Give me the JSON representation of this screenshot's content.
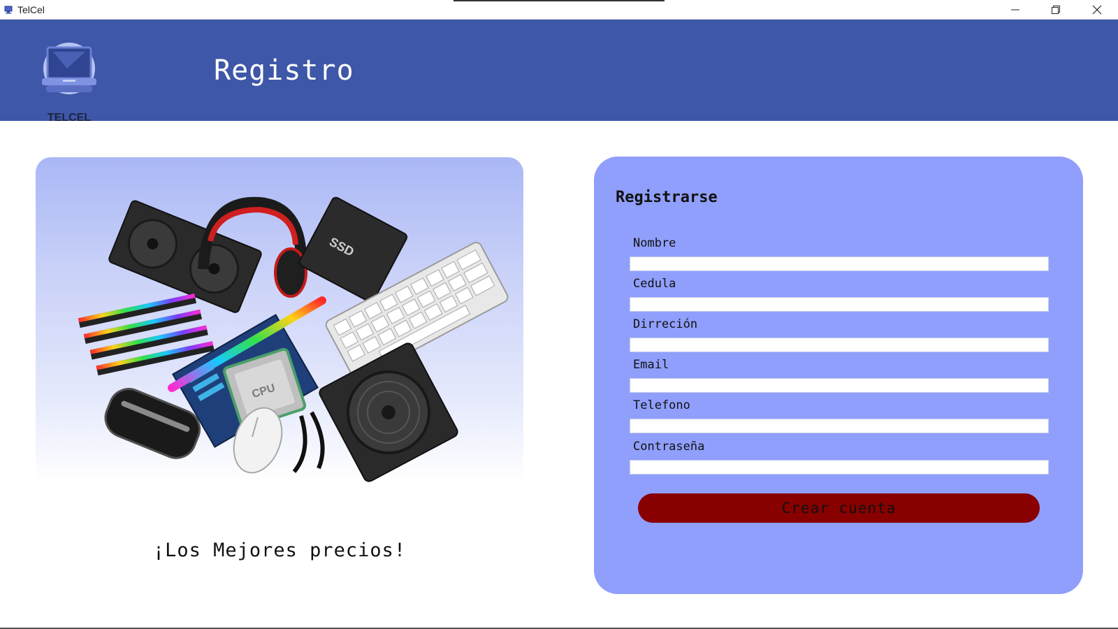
{
  "window": {
    "title": "TelCel",
    "app_icon": "computer-icon",
    "controls": [
      "minimize-icon",
      "restore-icon",
      "close-icon"
    ]
  },
  "header": {
    "logo_text": "TELCEL",
    "logo_icon": "laptop-icon",
    "title": "Registro",
    "background": "#3f57a8"
  },
  "hero": {
    "image": "computer-hardware-collage",
    "tagline": "¡Los Mejores precios!"
  },
  "form": {
    "heading": "Registrarse",
    "background": "#909ffc",
    "fields": [
      {
        "label": "Nombre",
        "value": ""
      },
      {
        "label": "Cedula",
        "value": ""
      },
      {
        "label": "Dirreción",
        "value": ""
      },
      {
        "label": "Email",
        "value": ""
      },
      {
        "label": "Telefono",
        "value": ""
      },
      {
        "label": "Contraseña",
        "value": ""
      }
    ],
    "submit_label": "Crear cuenta",
    "submit_color": "#880000"
  }
}
